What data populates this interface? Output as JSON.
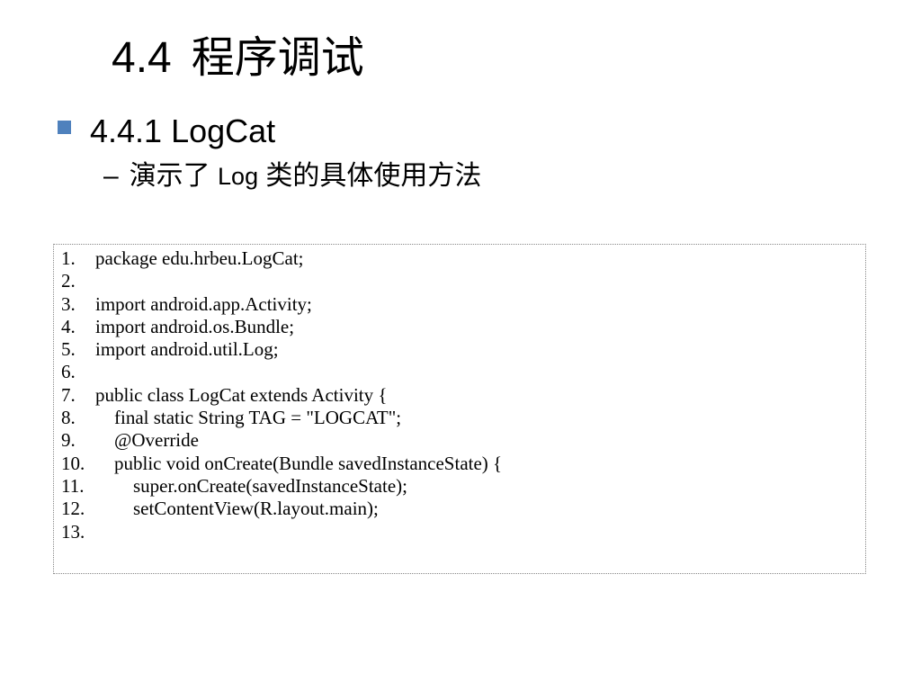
{
  "title": {
    "number": "4.4",
    "text": "程序调试"
  },
  "bullets": {
    "level1": "4.4.1 LogCat",
    "level2_dash": "–",
    "level2_pre": "演示了 ",
    "level2_latin": "Log",
    "level2_post": " 类的具体使用方法",
    "bullet_color": "#4f81bd"
  },
  "code": {
    "lines": [
      {
        "no": "1.",
        "text": "package edu.hrbeu.LogCat;"
      },
      {
        "no": "2.",
        "text": ""
      },
      {
        "no": "3.",
        "text": "import android.app.Activity;"
      },
      {
        "no": "4.",
        "text": "import android.os.Bundle;"
      },
      {
        "no": "5.",
        "text": "import android.util.Log;"
      },
      {
        "no": "6.",
        "text": ""
      },
      {
        "no": "7.",
        "text": "public class LogCat extends Activity {"
      },
      {
        "no": "8.",
        "text": "    final static String TAG = \"LOGCAT\";"
      },
      {
        "no": "9.",
        "text": "    @Override"
      },
      {
        "no": "10.",
        "text": "    public void onCreate(Bundle savedInstanceState) {"
      },
      {
        "no": "11.",
        "text": "        super.onCreate(savedInstanceState);"
      },
      {
        "no": "12.",
        "text": "        setContentView(R.layout.main);"
      },
      {
        "no": "13.",
        "text": ""
      }
    ]
  }
}
